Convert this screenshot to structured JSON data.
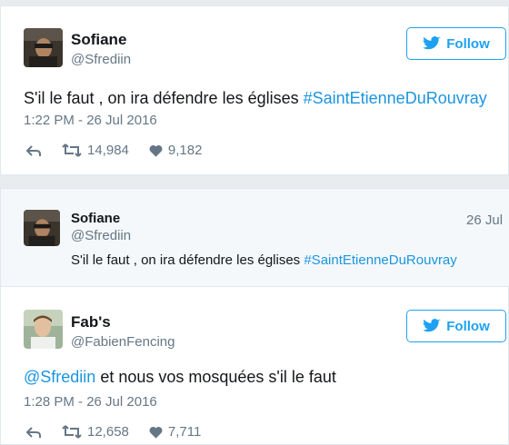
{
  "tweet1": {
    "name": "Sofiane",
    "handle": "@Sfrediin",
    "follow_label": "Follow",
    "text": "S'il le faut , on ira défendre les églises ",
    "hashtag": "#SaintEtienneDuRouvray",
    "time": "1:22 PM - 26 Jul 2016",
    "retweets": "14,984",
    "likes": "9,182"
  },
  "quoted": {
    "name": "Sofiane",
    "handle": "@Sfrediin",
    "date": "26 Jul",
    "text": "S'il le faut , on ira défendre les églises ",
    "hashtag": "#SaintEtienneDuRouvray"
  },
  "tweet2": {
    "name": "Fab's",
    "handle": "@FabienFencing",
    "follow_label": "Follow",
    "mention": "@Sfrediin",
    "text": " et nous vos mosquées s'il le faut",
    "time": "1:28 PM - 26 Jul 2016",
    "retweets": "12,658",
    "likes": "7,711"
  },
  "colors": {
    "accent": "#1da1f2",
    "link": "#1b95e0",
    "muted": "#657786"
  },
  "icons": [
    "bird-icon",
    "reply-icon",
    "retweet-icon",
    "heart-icon"
  ]
}
